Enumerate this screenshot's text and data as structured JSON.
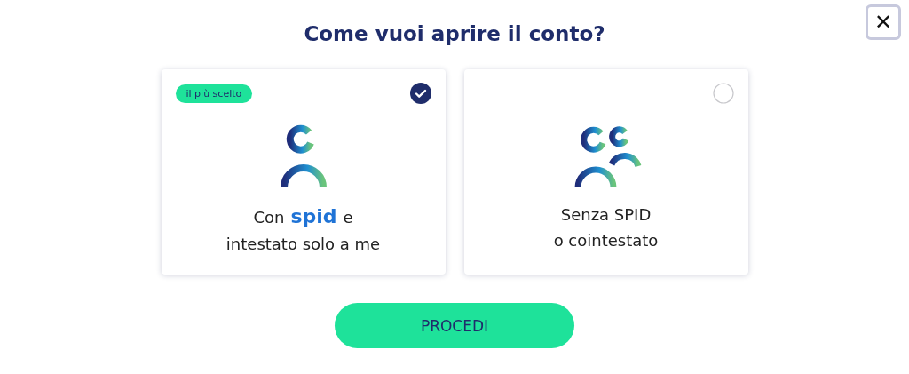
{
  "title": "Come vuoi aprire il conto?",
  "close_button": {
    "label": "✕"
  },
  "options": [
    {
      "kind": "single",
      "selected": true,
      "badge": "il più scelto",
      "line1": {
        "before": "Con",
        "logo": "spid",
        "after": "e"
      },
      "line2": "intestato solo a me"
    },
    {
      "kind": "joint",
      "selected": false,
      "line1": {
        "before": "Senza SPID"
      },
      "line2": "o cointestato"
    }
  ],
  "submit_button": {
    "label": "PROCEDI"
  }
}
